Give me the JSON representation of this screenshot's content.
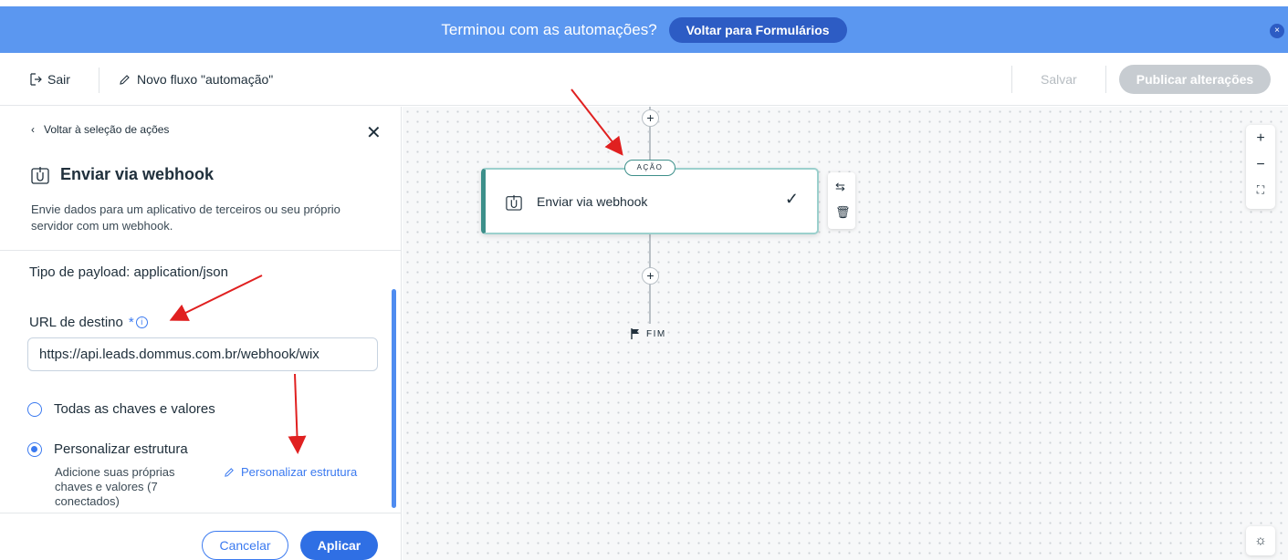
{
  "banner": {
    "text": "Terminou com as automações?",
    "button": "Voltar para Formulários",
    "close": "×"
  },
  "toolbar": {
    "exit": "Sair",
    "flow_name": "Novo fluxo \"automação\"",
    "save": "Salvar",
    "publish": "Publicar alterações"
  },
  "panel": {
    "back": "Voltar à seleção de ações",
    "title": "Enviar via webhook",
    "description": "Envie dados para um aplicativo de terceiros ou seu próprio servidor com um webhook.",
    "payload_label": "Tipo de payload:",
    "payload_value": "application/json",
    "url_label": "URL de destino",
    "url_required": "*",
    "url_value": "https://api.leads.dommus.com.br/webhook/wix",
    "radio_all": "Todas as chaves e valores",
    "radio_custom": "Personalizar estrutura",
    "radio_custom_sub": "Adicione suas próprias chaves e valores (7 conectados)",
    "custom_link": "Personalizar estrutura",
    "selected_option": "custom",
    "cancel": "Cancelar",
    "apply": "Aplicar"
  },
  "canvas": {
    "badge": "AÇÃO",
    "card_label": "Enviar via webhook",
    "end_label": "FIM",
    "plus": "+",
    "zoom_in": "+",
    "zoom_out": "−"
  },
  "colors": {
    "banner": "#5b97f0",
    "accent": "#3b7af0",
    "card_border": "#3d8f8a",
    "annotation_arrow": "#e02020"
  }
}
